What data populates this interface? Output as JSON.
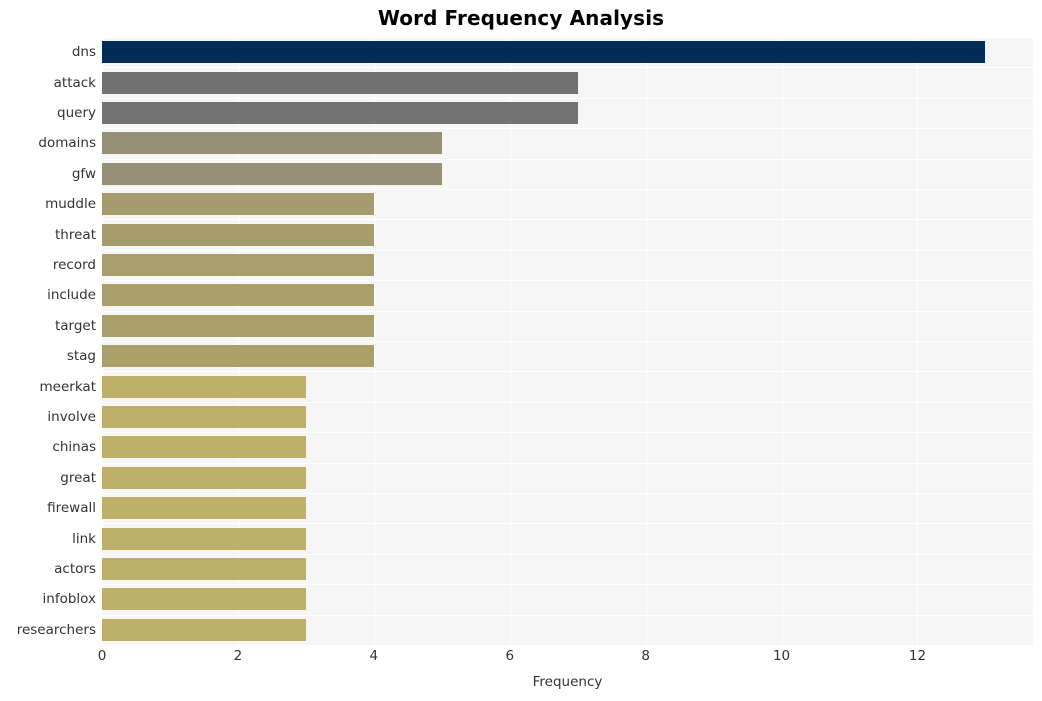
{
  "chart_data": {
    "type": "bar",
    "orientation": "horizontal",
    "title": "Word Frequency Analysis",
    "xlabel": "Frequency",
    "ylabel": "",
    "categories": [
      "dns",
      "attack",
      "query",
      "domains",
      "gfw",
      "muddle",
      "threat",
      "record",
      "include",
      "target",
      "stag",
      "meerkat",
      "involve",
      "chinas",
      "great",
      "firewall",
      "link",
      "actors",
      "infoblox",
      "researchers"
    ],
    "values": [
      13,
      7,
      7,
      5,
      5,
      4,
      4,
      4,
      4,
      4,
      4,
      3,
      3,
      3,
      3,
      3,
      3,
      3,
      3,
      3
    ],
    "bar_colors": [
      "#022b55",
      "#727272",
      "#737373",
      "#979076",
      "#979077",
      "#a49c6e",
      "#a69d6c",
      "#a79e6b",
      "#a89f6a",
      "#a99f6a",
      "#aaa069",
      "#bfb069",
      "#bfb069",
      "#bfb069",
      "#bfb069",
      "#bfb069",
      "#bfb069",
      "#bfb069",
      "#bfb069",
      "#bfb069"
    ],
    "xlim": [
      0,
      13.7
    ],
    "xticks": [
      0,
      2,
      4,
      6,
      8,
      10,
      12
    ],
    "xticklabels": [
      "0",
      "2",
      "4",
      "6",
      "8",
      "10",
      "12"
    ],
    "grid": true,
    "grid_color": "#ffffff",
    "plot_background": "#f6f6f6",
    "figure_background": "#ffffff",
    "legend": null
  }
}
